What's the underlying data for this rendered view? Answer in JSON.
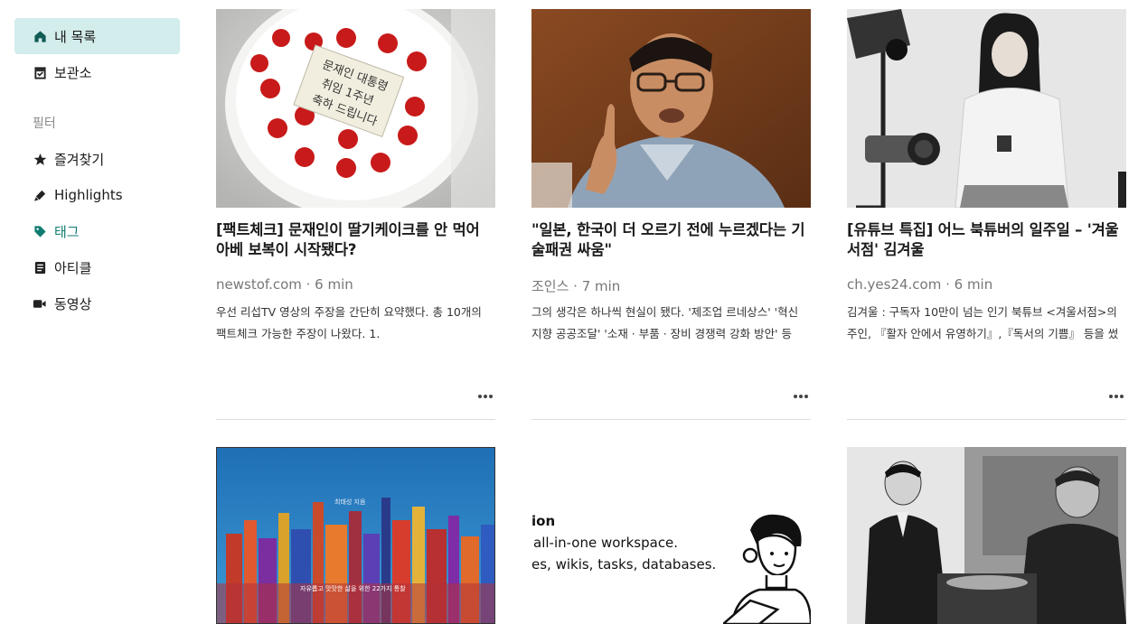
{
  "sidebar": {
    "items": [
      {
        "label": "내 목록",
        "icon": "home-icon",
        "active": true
      },
      {
        "label": "보관소",
        "icon": "archive-icon"
      }
    ],
    "filter_label": "필터",
    "filters": [
      {
        "label": "즐겨찾기",
        "icon": "star-icon"
      },
      {
        "label": "Highlights",
        "icon": "highlighter-icon"
      },
      {
        "label": "태그",
        "icon": "tag-icon"
      },
      {
        "label": "아티클",
        "icon": "article-icon"
      },
      {
        "label": "동영상",
        "icon": "video-icon"
      }
    ]
  },
  "cards": [
    {
      "title": "[팩트체크] 문재인이 딸기케이크를 안 먹어\n아베 보복이 시작됐다?",
      "meta": "newstof.com · 6 min",
      "excerpt": "우선 리섭TV 영상의 주장을 간단히 요약했다. 총 10개의\n팩트체크 가능한 주장이 나왔다. 1.",
      "image": "strawberry-cake",
      "cake_text": "문재인 대통령\n취임 1주년\n축하 드립니다"
    },
    {
      "title": "\"일본, 한국이 더 오르기 전에 누르겠다는 기\n술패권 싸움\"",
      "meta": "조인스 · 7 min",
      "excerpt": "그의 생각은 하나씩 현실이 됐다. '제조업 르네상스' '혁신\n지향 공공조달' '소재 · 부품 · 장비 경쟁력 강화 방안' 등",
      "image": "man-speaking"
    },
    {
      "title": "[유튜브 특집] 어느 북튜버의 일주일 – '겨울\n서점' 김겨울",
      "meta": "ch.yes24.com · 6 min",
      "excerpt": "김겨울 : 구독자 10만이 넘는 인기 북튜브 <겨울서점>의\n주인, 『활자 안에서 유영하기』,『독서의 기쁨』 등을 썼으며",
      "image": "woman-studio"
    },
    {
      "image": "city-painting-book",
      "cover_author": "최태성 지음",
      "cover_subtitle": "자유롭고 맛맛한 삶을 위한 22가지 통찰"
    },
    {
      "image": "notion-ad",
      "ad_lines": [
        "ion",
        "all-in-one workspace.",
        "es, wikis, tasks, databases."
      ]
    },
    {
      "image": "historic-photo"
    }
  ]
}
